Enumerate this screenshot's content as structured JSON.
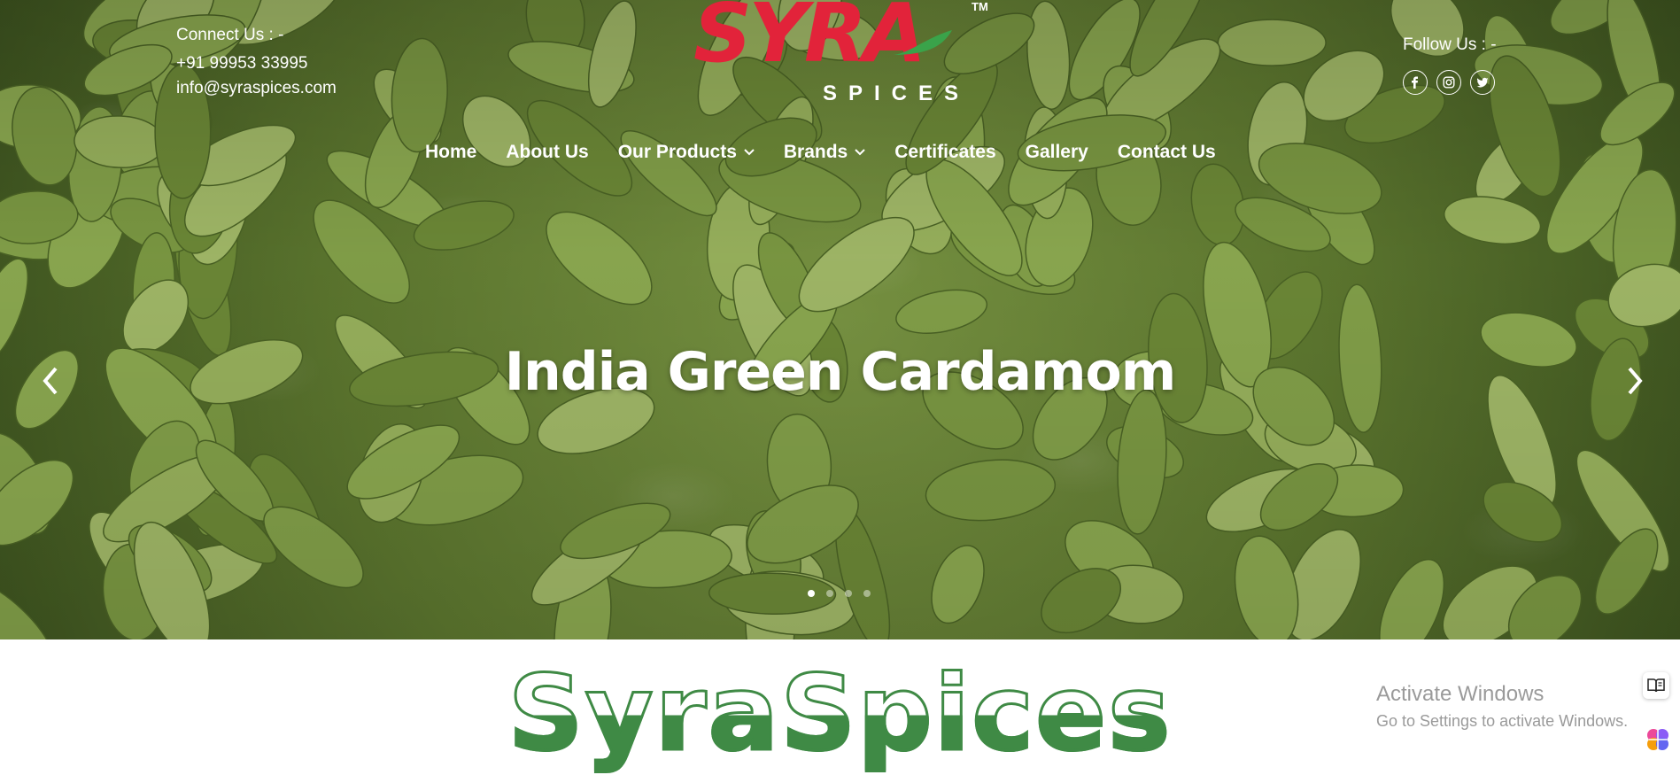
{
  "header": {
    "connect_label": "Connect Us : -",
    "phone": "+91 99953 33995",
    "email": "info@syraspices.com",
    "follow_label": "Follow Us : -"
  },
  "logo": {
    "word": "SYRA",
    "subtitle": "SPICES",
    "tm": "TM",
    "colors": {
      "primary": "#e2233a",
      "leaf": "#3aa34a"
    }
  },
  "socials": [
    {
      "icon": "facebook-icon"
    },
    {
      "icon": "instagram-icon"
    },
    {
      "icon": "twitter-icon"
    }
  ],
  "nav": {
    "items": [
      {
        "label": "Home",
        "dropdown": false
      },
      {
        "label": "About Us",
        "dropdown": false
      },
      {
        "label": "Our Products",
        "dropdown": true
      },
      {
        "label": "Brands",
        "dropdown": true
      },
      {
        "label": "Certificates",
        "dropdown": false
      },
      {
        "label": "Gallery",
        "dropdown": false
      },
      {
        "label": "Contact Us",
        "dropdown": false
      }
    ]
  },
  "slider": {
    "title": "India Green Cardamom",
    "slide_count": 4,
    "active_index": 0
  },
  "section": {
    "brand_heading": "SyraSpices",
    "heading_color": "#3f8a45"
  },
  "watermark": {
    "line1": "Activate Windows",
    "line2": "Go to Settings to activate Windows."
  }
}
